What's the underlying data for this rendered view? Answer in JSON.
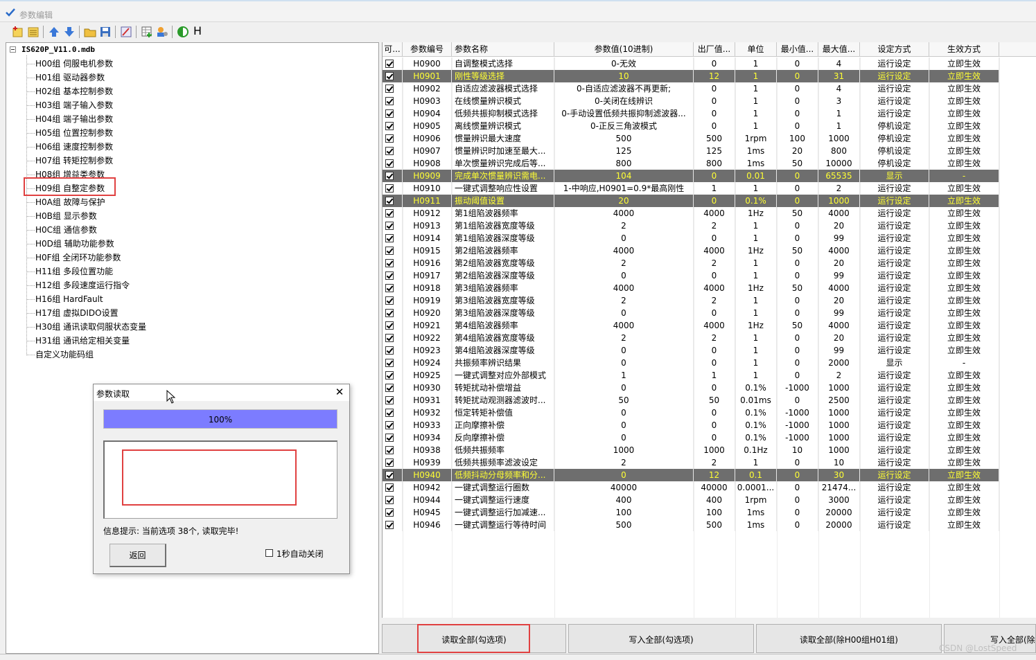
{
  "window": {
    "title": "参数编辑"
  },
  "toolbar": {
    "h_label": "H"
  },
  "tree": {
    "root": "IS620P_V11.0.mdb",
    "items": [
      "H00组 伺服电机参数",
      "H01组 驱动器参数",
      "H02组 基本控制参数",
      "H03组 端子输入参数",
      "H04组 端子输出参数",
      "H05组 位置控制参数",
      "H06组 速度控制参数",
      "H07组 转矩控制参数",
      "H08组 增益类参数",
      "H09组 自整定参数",
      "H0A组 故障与保护",
      "H0B组 显示参数",
      "H0C组 通信参数",
      "H0D组 辅助功能参数",
      "H0F组 全闭环功能参数",
      "H11组 多段位置功能",
      "H12组 多段速度运行指令",
      "H16组 HardFault",
      "H17组 虚拟DIDO设置",
      "H30组 通讯读取伺服状态变量",
      "H31组 通讯给定相关变量",
      "自定义功能码组"
    ]
  },
  "grid": {
    "columns": [
      "可...",
      "参数编号",
      "参数名称",
      "参数值(10进制)",
      "出厂值...",
      "单位",
      "最小值...",
      "最大值...",
      "设定方式",
      "生效方式"
    ],
    "rows": [
      {
        "id": "H0900",
        "name": "自调整模式选择",
        "value": "0-无效",
        "def": "0",
        "unit": "1",
        "min": "0",
        "max": "4",
        "set": "运行设定",
        "eff": "立即生效",
        "hl": false
      },
      {
        "id": "H0901",
        "name": "刚性等级选择",
        "value": "10",
        "def": "12",
        "unit": "1",
        "min": "0",
        "max": "31",
        "set": "运行设定",
        "eff": "立即生效",
        "hl": true
      },
      {
        "id": "H0902",
        "name": "自适应滤波器模式选择",
        "value": "0-自适应滤波器不再更新;",
        "def": "0",
        "unit": "1",
        "min": "0",
        "max": "4",
        "set": "运行设定",
        "eff": "立即生效",
        "hl": false
      },
      {
        "id": "H0903",
        "name": "在线惯量辨识模式",
        "value": "0-关闭在线辨识",
        "def": "0",
        "unit": "1",
        "min": "0",
        "max": "3",
        "set": "运行设定",
        "eff": "立即生效",
        "hl": false
      },
      {
        "id": "H0904",
        "name": "低频共振抑制模式选择",
        "value": "0-手动设置低频共振抑制滤波器...",
        "def": "0",
        "unit": "1",
        "min": "0",
        "max": "1",
        "set": "运行设定",
        "eff": "立即生效",
        "hl": false
      },
      {
        "id": "H0905",
        "name": "离线惯量辨识模式",
        "value": "0-正反三角波模式",
        "def": "0",
        "unit": "1",
        "min": "0",
        "max": "1",
        "set": "停机设定",
        "eff": "立即生效",
        "hl": false
      },
      {
        "id": "H0906",
        "name": "惯量辨识最大速度",
        "value": "500",
        "def": "500",
        "unit": "1rpm",
        "min": "100",
        "max": "1000",
        "set": "停机设定",
        "eff": "立即生效",
        "hl": false
      },
      {
        "id": "H0907",
        "name": "惯量辨识时加速至最大...",
        "value": "125",
        "def": "125",
        "unit": "1ms",
        "min": "20",
        "max": "800",
        "set": "停机设定",
        "eff": "立即生效",
        "hl": false
      },
      {
        "id": "H0908",
        "name": "单次惯量辨识完成后等...",
        "value": "800",
        "def": "800",
        "unit": "1ms",
        "min": "50",
        "max": "10000",
        "set": "停机设定",
        "eff": "立即生效",
        "hl": false
      },
      {
        "id": "H0909",
        "name": "完成单次惯量辨识需电...",
        "value": "104",
        "def": "0",
        "unit": "0.01",
        "min": "0",
        "max": "65535",
        "set": "显示",
        "eff": "-",
        "hl": true
      },
      {
        "id": "H0910",
        "name": "一键式调整响应性设置",
        "value": "1-中响应,H0901=0.9*最高刚性",
        "def": "1",
        "unit": "1",
        "min": "0",
        "max": "2",
        "set": "运行设定",
        "eff": "立即生效",
        "hl": false
      },
      {
        "id": "H0911",
        "name": "振动阈值设置",
        "value": "20",
        "def": "0",
        "unit": "0.1%",
        "min": "0",
        "max": "1000",
        "set": "运行设定",
        "eff": "立即生效",
        "hl": true
      },
      {
        "id": "H0912",
        "name": "第1组陷波器频率",
        "value": "4000",
        "def": "4000",
        "unit": "1Hz",
        "min": "50",
        "max": "4000",
        "set": "运行设定",
        "eff": "立即生效",
        "hl": false
      },
      {
        "id": "H0913",
        "name": "第1组陷波器宽度等级",
        "value": "2",
        "def": "2",
        "unit": "1",
        "min": "0",
        "max": "20",
        "set": "运行设定",
        "eff": "立即生效",
        "hl": false
      },
      {
        "id": "H0914",
        "name": "第1组陷波器深度等级",
        "value": "0",
        "def": "0",
        "unit": "1",
        "min": "0",
        "max": "99",
        "set": "运行设定",
        "eff": "立即生效",
        "hl": false
      },
      {
        "id": "H0915",
        "name": "第2组陷波器频率",
        "value": "4000",
        "def": "4000",
        "unit": "1Hz",
        "min": "50",
        "max": "4000",
        "set": "运行设定",
        "eff": "立即生效",
        "hl": false
      },
      {
        "id": "H0916",
        "name": "第2组陷波器宽度等级",
        "value": "2",
        "def": "2",
        "unit": "1",
        "min": "0",
        "max": "20",
        "set": "运行设定",
        "eff": "立即生效",
        "hl": false
      },
      {
        "id": "H0917",
        "name": "第2组陷波器深度等级",
        "value": "0",
        "def": "0",
        "unit": "1",
        "min": "0",
        "max": "99",
        "set": "运行设定",
        "eff": "立即生效",
        "hl": false
      },
      {
        "id": "H0918",
        "name": "第3组陷波器频率",
        "value": "4000",
        "def": "4000",
        "unit": "1Hz",
        "min": "50",
        "max": "4000",
        "set": "运行设定",
        "eff": "立即生效",
        "hl": false
      },
      {
        "id": "H0919",
        "name": "第3组陷波器宽度等级",
        "value": "2",
        "def": "2",
        "unit": "1",
        "min": "0",
        "max": "20",
        "set": "运行设定",
        "eff": "立即生效",
        "hl": false
      },
      {
        "id": "H0920",
        "name": "第3组陷波器深度等级",
        "value": "0",
        "def": "0",
        "unit": "1",
        "min": "0",
        "max": "99",
        "set": "运行设定",
        "eff": "立即生效",
        "hl": false
      },
      {
        "id": "H0921",
        "name": "第4组陷波器频率",
        "value": "4000",
        "def": "4000",
        "unit": "1Hz",
        "min": "50",
        "max": "4000",
        "set": "运行设定",
        "eff": "立即生效",
        "hl": false
      },
      {
        "id": "H0922",
        "name": "第4组陷波器宽度等级",
        "value": "2",
        "def": "2",
        "unit": "1",
        "min": "0",
        "max": "20",
        "set": "运行设定",
        "eff": "立即生效",
        "hl": false
      },
      {
        "id": "H0923",
        "name": "第4组陷波器深度等级",
        "value": "0",
        "def": "0",
        "unit": "1",
        "min": "0",
        "max": "99",
        "set": "运行设定",
        "eff": "立即生效",
        "hl": false
      },
      {
        "id": "H0924",
        "name": "共振频率辨识结果",
        "value": "0",
        "def": "0",
        "unit": "1",
        "min": "0",
        "max": "2000",
        "set": "显示",
        "eff": "-",
        "hl": false
      },
      {
        "id": "H0925",
        "name": "一键式调整对应外部模式",
        "value": "1",
        "def": "1",
        "unit": "1",
        "min": "0",
        "max": "2",
        "set": "运行设定",
        "eff": "立即生效",
        "hl": false
      },
      {
        "id": "H0930",
        "name": "转矩扰动补偿增益",
        "value": "0",
        "def": "0",
        "unit": "0.1%",
        "min": "-1000",
        "max": "1000",
        "set": "运行设定",
        "eff": "立即生效",
        "hl": false
      },
      {
        "id": "H0931",
        "name": "转矩扰动观测器滤波时...",
        "value": "50",
        "def": "50",
        "unit": "0.01ms",
        "min": "0",
        "max": "2500",
        "set": "运行设定",
        "eff": "立即生效",
        "hl": false
      },
      {
        "id": "H0932",
        "name": "恒定转矩补偿值",
        "value": "0",
        "def": "0",
        "unit": "0.1%",
        "min": "-1000",
        "max": "1000",
        "set": "运行设定",
        "eff": "立即生效",
        "hl": false
      },
      {
        "id": "H0933",
        "name": "正向摩擦补偿",
        "value": "0",
        "def": "0",
        "unit": "0.1%",
        "min": "-1000",
        "max": "1000",
        "set": "运行设定",
        "eff": "立即生效",
        "hl": false
      },
      {
        "id": "H0934",
        "name": "反向摩擦补偿",
        "value": "0",
        "def": "0",
        "unit": "0.1%",
        "min": "-1000",
        "max": "1000",
        "set": "运行设定",
        "eff": "立即生效",
        "hl": false
      },
      {
        "id": "H0938",
        "name": "低频共振频率",
        "value": "1000",
        "def": "1000",
        "unit": "0.1Hz",
        "min": "10",
        "max": "1000",
        "set": "运行设定",
        "eff": "立即生效",
        "hl": false
      },
      {
        "id": "H0939",
        "name": "低频共振频率滤波设定",
        "value": "2",
        "def": "2",
        "unit": "1",
        "min": "0",
        "max": "10",
        "set": "运行设定",
        "eff": "立即生效",
        "hl": false
      },
      {
        "id": "H0940",
        "name": "低频抖动分母频率和分...",
        "value": "0",
        "def": "12",
        "unit": "0.1",
        "min": "0",
        "max": "30",
        "set": "运行设定",
        "eff": "立即生效",
        "hl": true
      },
      {
        "id": "H0942",
        "name": "一键式调整运行圈数",
        "value": "40000",
        "def": "40000",
        "unit": "0.0001...",
        "min": "0",
        "max": "21474...",
        "set": "运行设定",
        "eff": "立即生效",
        "hl": false
      },
      {
        "id": "H0944",
        "name": "一键式调整运行速度",
        "value": "400",
        "def": "400",
        "unit": "1rpm",
        "min": "0",
        "max": "3000",
        "set": "运行设定",
        "eff": "立即生效",
        "hl": false
      },
      {
        "id": "H0945",
        "name": "一键式调整运行加减速...",
        "value": "100",
        "def": "100",
        "unit": "1ms",
        "min": "0",
        "max": "20000",
        "set": "运行设定",
        "eff": "立即生效",
        "hl": false
      },
      {
        "id": "H0946",
        "name": "一键式调整运行等待时间",
        "value": "500",
        "def": "500",
        "unit": "1ms",
        "min": "0",
        "max": "20000",
        "set": "运行设定",
        "eff": "立即生效",
        "hl": false
      }
    ]
  },
  "buttons": {
    "read_all_checked": "读取全部(勾选项)",
    "write_all_checked": "写入全部(勾选项)",
    "read_all_except": "读取全部(除H00组H01组)",
    "write_all_except": "写入全部(除"
  },
  "dialog": {
    "title": "参数读取",
    "progress_label": "100%",
    "progress": 1.0,
    "info": "信息提示: 当前选项 38个, 读取完毕!",
    "back_button": "返回",
    "auto_close_label": "1秒自动关闭"
  },
  "watermark": "CSDN @LostSpeed",
  "colors": {
    "highlight_row": "#6e6e6e",
    "highlight_text": "#ffff33",
    "progress": "#7c7cff",
    "annotation_red": "#e04040"
  }
}
